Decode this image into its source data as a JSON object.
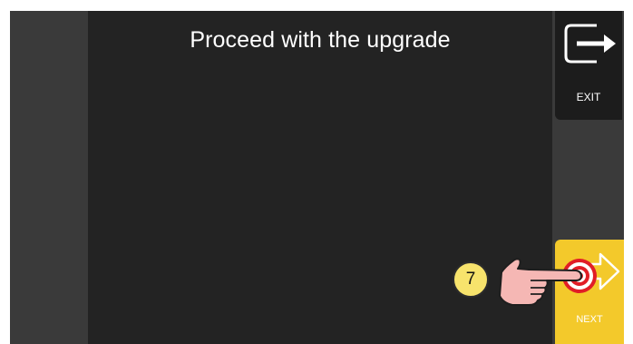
{
  "main": {
    "title": "Proceed with the upgrade"
  },
  "exit": {
    "label": "EXIT",
    "icon": "exit-arrow-icon"
  },
  "next": {
    "label": "NEXT",
    "icon": "arrow-right-icon"
  },
  "annotation": {
    "step_number": "7",
    "icon": "pointing-hand-icon"
  },
  "colors": {
    "background": "#232323",
    "side": "#3a3a3a",
    "exit_button": "#1c1c1c",
    "next_button": "#f3c92b",
    "target_ring": "#e11d26",
    "badge": "#f7e36c",
    "hand": "#f5b7b4"
  }
}
